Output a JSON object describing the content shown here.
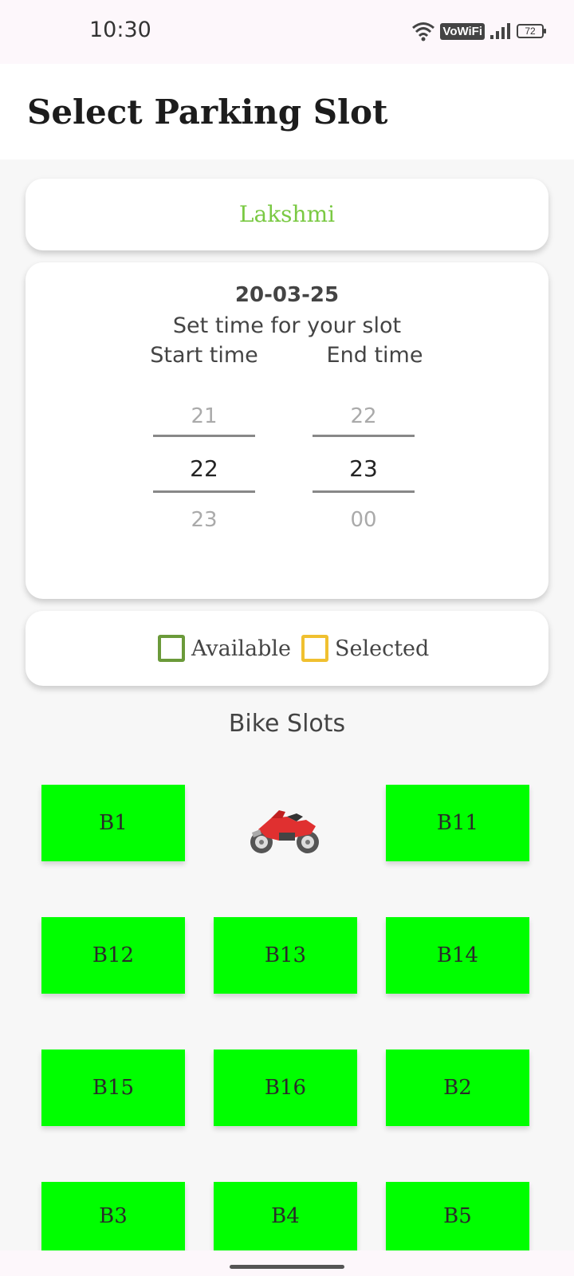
{
  "status_bar": {
    "time": "10:30",
    "vowifi": "VoWiFi",
    "battery": "72"
  },
  "header": {
    "title": "Select Parking Slot"
  },
  "location": {
    "name": "Lakshmi",
    "color": "#7ac943"
  },
  "time_selection": {
    "date": "20-03-25",
    "instruction": "Set time for your slot",
    "start_label": "Start time",
    "end_label": "End time",
    "start_picker": {
      "prev": "21",
      "current": "22",
      "next": "23"
    },
    "end_picker": {
      "prev": "22",
      "current": "23",
      "next": "00"
    }
  },
  "legend": {
    "available": {
      "label": "Available",
      "color": "#6b9a3a"
    },
    "selected": {
      "label": "Selected",
      "color": "#f0c030"
    }
  },
  "section": {
    "title": "Bike Slots",
    "icon": "motorcycle-icon"
  },
  "slots": [
    "B1",
    "B11",
    "B12",
    "B13",
    "B14",
    "B15",
    "B16",
    "B2",
    "B3",
    "B4",
    "B5"
  ],
  "colors": {
    "slot_available": "#00ff00"
  }
}
